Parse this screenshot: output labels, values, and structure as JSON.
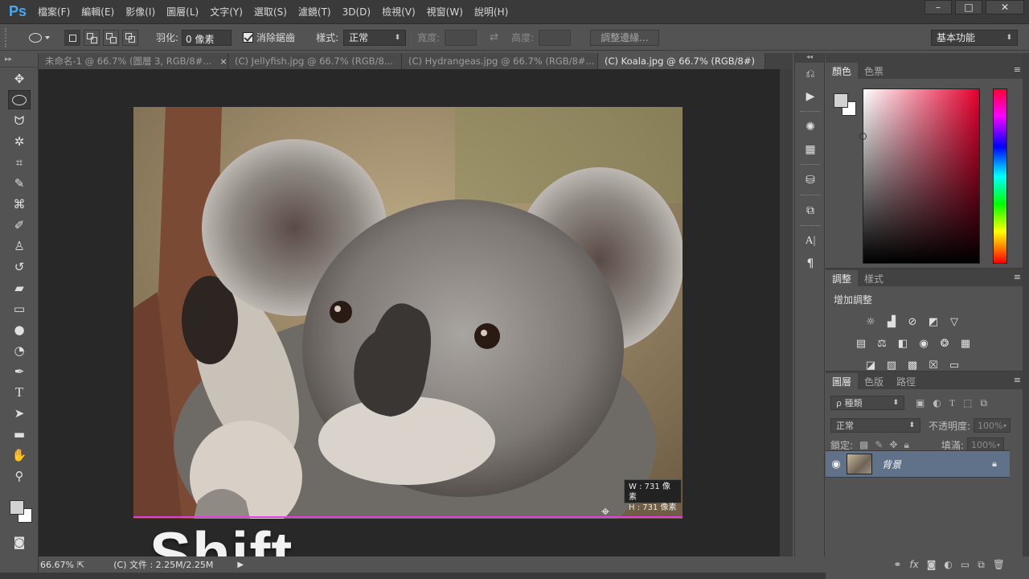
{
  "app": {
    "logo": "Ps"
  },
  "menu": [
    "檔案(F)",
    "編輯(E)",
    "影像(I)",
    "圖層(L)",
    "文字(Y)",
    "選取(S)",
    "濾鏡(T)",
    "3D(D)",
    "檢視(V)",
    "視窗(W)",
    "說明(H)"
  ],
  "window": {
    "minimize": "–",
    "maximize": "□",
    "close": "✕"
  },
  "options": {
    "feather_label": "羽化:",
    "feather_value": "0 像素",
    "antialias_label": "消除鋸齒",
    "style_label": "樣式:",
    "style_value": "正常",
    "width_label": "寬度:",
    "height_label": "高度:",
    "refine_edge": "調整邊緣...",
    "workspace": "基本功能"
  },
  "tabs": [
    {
      "label": "未命名-1 @ 66.7% (圖層 3, RGB/8#...",
      "close": "×"
    },
    {
      "label": "(C) Jellyfish.jpg @ 66.7% (RGB/8...",
      "close": "×"
    },
    {
      "label": "(C) Hydrangeas.jpg @ 66.7% (RGB/8#...",
      "close": "×"
    },
    {
      "label": "(C) Koala.jpg @ 66.7% (RGB/8#)",
      "close": "×"
    }
  ],
  "canvas": {
    "overlay_text": "Shift",
    "size_w": "W :  731 像素",
    "size_h": "H :  731 像素"
  },
  "status": {
    "zoom": "66.67%",
    "docinfo": "(C) 文件 : 2.25M/2.25M"
  },
  "panels": {
    "color_tabs": [
      "顏色",
      "色票"
    ],
    "adj_tabs": [
      "調整",
      "樣式"
    ],
    "adj_title": "增加調整",
    "layer_tabs": [
      "圖層",
      "色版",
      "路徑"
    ],
    "layer_kind": "ρ 種類",
    "blend_mode": "正常",
    "opacity_label": "不透明度:",
    "opacity_value": "100%",
    "lock_label": "鎖定:",
    "fill_label": "填滿:",
    "fill_value": "100%",
    "layer_name": "背景"
  },
  "colors": {
    "fg": "#d2d2d2",
    "bg": "#ffffff",
    "selected_layer": "#5f7289",
    "accent": "#49a7f0"
  }
}
